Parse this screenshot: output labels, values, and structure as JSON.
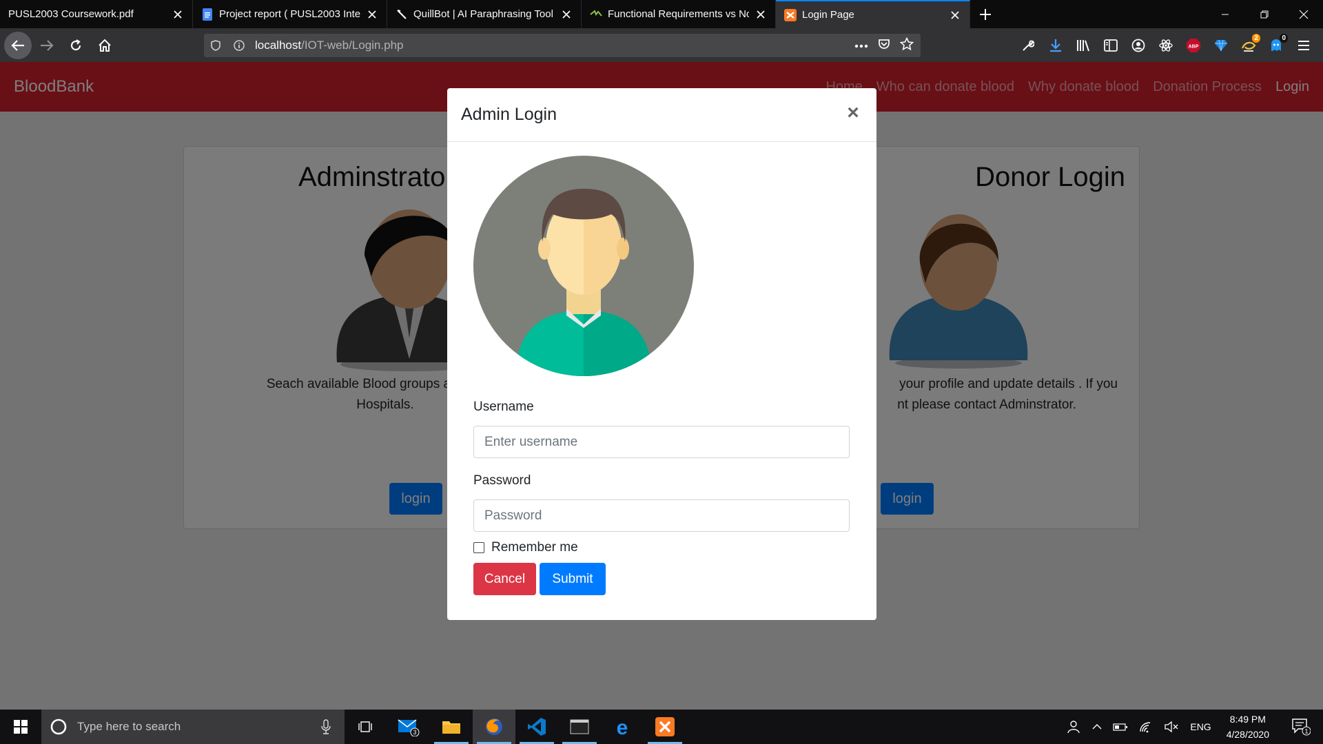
{
  "browser": {
    "tabs": [
      {
        "title": "PUSL2003 Coursework.pdf",
        "icon": "pdf-icon",
        "active": false
      },
      {
        "title": "Project report ( PUSL2003 Integ",
        "icon": "google-docs-icon",
        "active": false
      },
      {
        "title": "QuillBot | AI Paraphrasing Tool",
        "icon": "quillbot-icon",
        "active": false
      },
      {
        "title": "Functional Requirements vs No",
        "icon": "website-icon",
        "active": false
      },
      {
        "title": "Login Page",
        "icon": "xampp-icon",
        "active": true
      }
    ],
    "url": {
      "host": "localhost",
      "path": "/IOT-web/Login.php"
    },
    "badges": {
      "notifications": "2",
      "messages": "0"
    },
    "accent": "#0a84ff"
  },
  "site": {
    "brand": "BloodBank",
    "nav_links": [
      "Home",
      "Who can donate blood",
      "Why donate blood",
      "Donation Process",
      "Login"
    ],
    "nav_color": "#d21f2d",
    "admin_card": {
      "title": "Adminstrator Login",
      "text_line1": "Seach available Blood groups and Count",
      "text_line2": "Hospitals.",
      "button": "login"
    },
    "donor_card": {
      "title": "Donor Login",
      "text_line1": "your profile and update details . If you",
      "text_line2": "nt please contact Adminstrator.",
      "button": "login"
    }
  },
  "modal": {
    "title": "Admin Login",
    "close": "×",
    "username_label": "Username",
    "username_placeholder": "Enter username",
    "password_label": "Password",
    "password_placeholder": "Password",
    "remember_label": "Remember me",
    "cancel_button": "Cancel",
    "submit_button": "Submit"
  },
  "taskbar": {
    "search_placeholder": "Type here to search",
    "mail_badge": "3",
    "language": "ENG",
    "time": "8:49 PM",
    "date": "4/28/2020",
    "notification_count": "1"
  }
}
